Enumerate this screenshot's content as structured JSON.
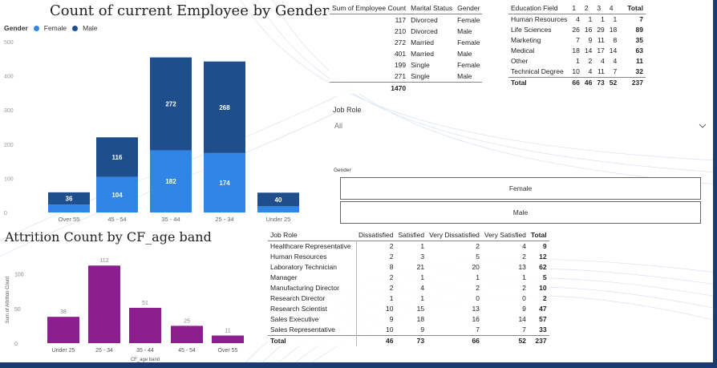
{
  "gender_chart": {
    "title": "Count of current Employee by Gender",
    "legend_title": "Gender",
    "legend": [
      {
        "name": "Female",
        "color": "#2f86e6"
      },
      {
        "name": "Male",
        "color": "#1f4e8c"
      }
    ],
    "y_ticks": [
      "500",
      "400",
      "300",
      "200",
      "100",
      "0"
    ],
    "chart_data": {
      "type": "bar",
      "stacked": true,
      "categories": [
        "Over 55",
        "45 - 54",
        "35 - 44",
        "25 - 34",
        "Under 25"
      ],
      "ylim": [
        0,
        500
      ],
      "series": [
        {
          "name": "Female",
          "color": "#2f86e6",
          "values": [
            23,
            104,
            182,
            174,
            18
          ],
          "labels": [
            "",
            "104",
            "182",
            "174",
            ""
          ]
        },
        {
          "name": "Male",
          "color": "#1f4e8c",
          "values": [
            36,
            116,
            272,
            268,
            40
          ],
          "labels": [
            "36",
            "116",
            "272",
            "268",
            "40"
          ]
        }
      ]
    }
  },
  "marital_table": {
    "headers": [
      "Sum of Employee Count",
      "Marital Status",
      "Gender"
    ],
    "rows": [
      [
        "117",
        "Divorced",
        "Female"
      ],
      [
        "210",
        "Divorced",
        "Male"
      ],
      [
        "272",
        "Married",
        "Female"
      ],
      [
        "401",
        "Married",
        "Male"
      ],
      [
        "199",
        "Single",
        "Female"
      ],
      [
        "271",
        "Single",
        "Male"
      ]
    ],
    "total": "1470"
  },
  "edu_table": {
    "headers": [
      "Education Field",
      "1",
      "2",
      "3",
      "4",
      "Total"
    ],
    "rows": [
      [
        "Human Resources",
        "4",
        "1",
        "1",
        "1",
        "7"
      ],
      [
        "Life Sciences",
        "26",
        "16",
        "29",
        "18",
        "89"
      ],
      [
        "Marketing",
        "7",
        "9",
        "11",
        "8",
        "35"
      ],
      [
        "Medical",
        "18",
        "14",
        "17",
        "14",
        "63"
      ],
      [
        "Other",
        "1",
        "2",
        "4",
        "4",
        "11"
      ],
      [
        "Technical Degree",
        "10",
        "4",
        "11",
        "7",
        "32"
      ]
    ],
    "total_row": [
      "Total",
      "66",
      "46",
      "73",
      "52",
      "237"
    ]
  },
  "job_role_slicer": {
    "title": "Job Role",
    "value": "All"
  },
  "gender_slicer": {
    "title": "Gender",
    "options": [
      "Female",
      "Male"
    ]
  },
  "attrition_chart": {
    "title": "Attrition Count by CF_age band",
    "ylabel": "Sum of Attrition Count",
    "xlabel": "CF_age band",
    "y_ticks": [
      "100",
      "50",
      "0"
    ],
    "chart_data": {
      "type": "bar",
      "categories": [
        "Under 25",
        "25 - 34",
        "35 - 44",
        "45 - 54",
        "Over 55"
      ],
      "values": [
        38,
        112,
        51,
        25,
        11
      ],
      "color": "#8b1f8f",
      "ylim": [
        0,
        125
      ]
    }
  },
  "jobrole_table": {
    "headers": [
      "Job Role",
      "Dissatisfied",
      "Satisfied",
      "Very Dissatisfied",
      "Very Satisfied",
      "Total"
    ],
    "rows": [
      [
        "Healthcare Representative",
        "2",
        "1",
        "2",
        "4",
        "9"
      ],
      [
        "Human Resources",
        "2",
        "3",
        "5",
        "2",
        "12"
      ],
      [
        "Laboratory Technician",
        "8",
        "21",
        "20",
        "13",
        "62"
      ],
      [
        "Manager",
        "2",
        "1",
        "1",
        "1",
        "5"
      ],
      [
        "Manufacturing Director",
        "2",
        "4",
        "2",
        "2",
        "10"
      ],
      [
        "Research Director",
        "1",
        "1",
        "0",
        "0",
        "2"
      ],
      [
        "Research Scientist",
        "10",
        "15",
        "13",
        "9",
        "47"
      ],
      [
        "Sales Executive",
        "9",
        "18",
        "16",
        "14",
        "57"
      ],
      [
        "Sales Representative",
        "10",
        "9",
        "7",
        "7",
        "33"
      ]
    ],
    "total_row": [
      "Total",
      "46",
      "73",
      "66",
      "52",
      "237"
    ]
  }
}
